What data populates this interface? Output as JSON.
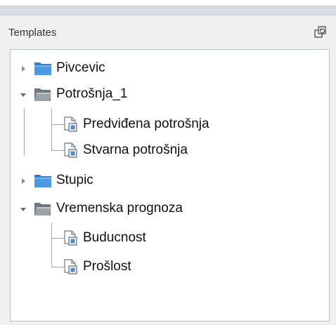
{
  "panel": {
    "title": "Templates",
    "refresh_icon": "refresh-icon"
  },
  "tree": {
    "items": [
      {
        "label": "Pivcevic",
        "type": "folder",
        "expanded": false
      },
      {
        "label": "Potrošnja_1",
        "type": "folder",
        "expanded": true,
        "children": [
          {
            "label": "Predviđena potrošnja",
            "type": "report"
          },
          {
            "label": "Stvarna potrošnja",
            "type": "report"
          }
        ]
      },
      {
        "label": "Stupic",
        "type": "folder",
        "expanded": false
      },
      {
        "label": "Vremenska prognoza",
        "type": "folder",
        "expanded": true,
        "children": [
          {
            "label": "Buducnost",
            "type": "report"
          },
          {
            "label": "Prošlost",
            "type": "report"
          }
        ]
      }
    ]
  },
  "colors": {
    "folder_blue": "#3f8fd8",
    "folder_gray": "#8a939c",
    "tree_line": "#a0a6ae"
  }
}
